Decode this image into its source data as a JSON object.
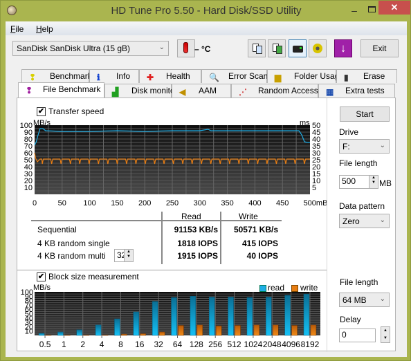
{
  "window": {
    "title": "HD Tune Pro 5.50 - Hard Disk/SSD Utility",
    "minimize_label": "–",
    "close_label": "✕"
  },
  "menu": {
    "items": [
      {
        "label": "File",
        "accel": "F"
      },
      {
        "label": "Help",
        "accel": "H"
      }
    ]
  },
  "toolbar": {
    "drive_selected": "SanDisk SanDisk Ultra (15 gB)",
    "temperature": "– °C",
    "icons": [
      "copy-info-icon",
      "copy-screenshot-icon",
      "screenshot-camera-icon",
      "options-gear-icon",
      "save-download-icon"
    ],
    "exit_label": "Exit"
  },
  "tabs_row1": [
    {
      "label": "Benchmark",
      "icon": "benchmark-icon"
    },
    {
      "label": "Info",
      "icon": "info-icon"
    },
    {
      "label": "Health",
      "icon": "health-icon"
    },
    {
      "label": "Error Scan",
      "icon": "error-scan-icon"
    },
    {
      "label": "Folder Usage",
      "icon": "folder-icon"
    },
    {
      "label": "Erase",
      "icon": "trash-icon"
    }
  ],
  "tabs_row2": [
    {
      "label": "File Benchmark",
      "icon": "file-benchmark-icon",
      "active": true
    },
    {
      "label": "Disk monitor",
      "icon": "disk-monitor-icon"
    },
    {
      "label": "AAM",
      "icon": "speaker-icon"
    },
    {
      "label": "Random Access",
      "icon": "random-access-icon"
    },
    {
      "label": "Extra tests",
      "icon": "extra-tests-icon"
    }
  ],
  "transfer": {
    "checkbox_label": "Transfer speed",
    "checked": true
  },
  "results": {
    "headers": [
      "Read",
      "Write"
    ],
    "rows": [
      {
        "label": "Sequential",
        "read": "91153 KB/s",
        "write": "50571 KB/s"
      },
      {
        "label": "4 KB random single",
        "read": "1818 IOPS",
        "write": "415 IOPS"
      },
      {
        "label": "4 KB random multi",
        "read": "1915 IOPS",
        "write": "40 IOPS",
        "queue_depth": "32"
      }
    ]
  },
  "side": {
    "start_label": "Start",
    "drive_label": "Drive",
    "drive_value": "F:",
    "file_length_label": "File length",
    "file_length_value": "500",
    "file_length_unit": "MB",
    "pattern_label": "Data pattern",
    "pattern_value": "Zero"
  },
  "block": {
    "checkbox_label": "Block size measurement",
    "checked": true,
    "file_length_label": "File length",
    "file_length_value": "64 MB",
    "delay_label": "Delay",
    "delay_value": "0"
  },
  "colors": {
    "read": "#1eaee6",
    "write": "#e87d12",
    "chart_bg": "#1c1c1c",
    "frame": "#aab54f"
  },
  "chart_data": [
    {
      "type": "line",
      "title": "Transfer speed",
      "xlabel": "mB",
      "ylabel": "MB/s",
      "y2label": "ms",
      "xlim": [
        0,
        500
      ],
      "ylim": [
        0,
        100
      ],
      "y2lim": [
        0,
        50
      ],
      "x_ticks": [
        "0",
        "50",
        "100",
        "150",
        "200",
        "250",
        "300",
        "350",
        "400",
        "450",
        "500mB"
      ],
      "y_ticks": [
        "10",
        "20",
        "30",
        "40",
        "50",
        "60",
        "70",
        "80",
        "90",
        "100"
      ],
      "y2_ticks": [
        "5",
        "10",
        "15",
        "20",
        "25",
        "30",
        "35",
        "40",
        "45",
        "50"
      ],
      "grid": true,
      "series": [
        {
          "name": "read",
          "x": [
            0,
            3,
            6,
            10,
            15,
            20,
            50,
            100,
            150,
            200,
            250,
            300,
            315,
            320,
            350,
            400,
            450,
            480,
            485,
            490,
            495,
            500
          ],
          "values": [
            71,
            76,
            85,
            95,
            95,
            92,
            91,
            91,
            92,
            91,
            92,
            92,
            94,
            92,
            92,
            92,
            92,
            92,
            86,
            76,
            75,
            75
          ]
        },
        {
          "name": "write",
          "x": [
            0,
            2,
            5,
            10,
            20,
            50,
            100,
            150,
            200,
            250,
            300,
            350,
            400,
            450,
            495,
            500
          ],
          "values": [
            60,
            52,
            47,
            51,
            51,
            50,
            50,
            51,
            51,
            51,
            51,
            51,
            51,
            51,
            51,
            51
          ],
          "dips_every": 17,
          "dip_value": 44
        }
      ]
    },
    {
      "type": "bar",
      "title": "Block size measurement",
      "ylabel": "MB/s",
      "ylim": [
        0,
        100
      ],
      "y_ticks": [
        "10",
        "20",
        "30",
        "40",
        "50",
        "60",
        "70",
        "80",
        "90",
        "100"
      ],
      "categories": [
        "0.5",
        "1",
        "2",
        "4",
        "8",
        "16",
        "32",
        "64",
        "128",
        "256",
        "512",
        "1024",
        "2048",
        "4096",
        "8192"
      ],
      "legend": "top-right",
      "series": [
        {
          "name": "read",
          "values": [
            5,
            8,
            13,
            24,
            38,
            54,
            78,
            87,
            90,
            88,
            88,
            87,
            88,
            92,
            95
          ]
        },
        {
          "name": "write",
          "values": [
            1,
            1,
            1,
            1,
            3,
            4,
            8,
            23,
            24,
            22,
            23,
            24,
            24,
            23,
            24
          ]
        }
      ]
    }
  ]
}
